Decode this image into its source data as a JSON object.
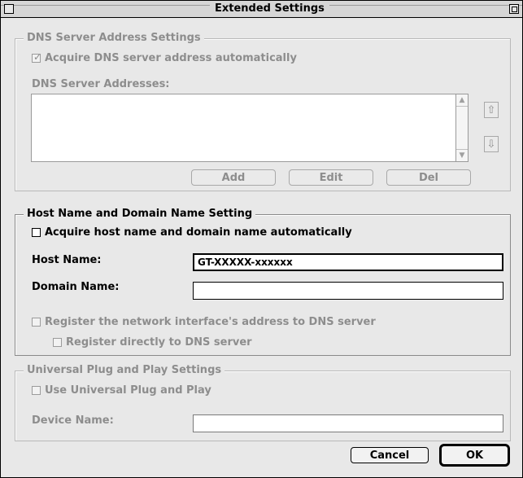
{
  "window": {
    "title": "Extended Settings"
  },
  "dns": {
    "legend": "DNS Server Address Settings",
    "acquire_label": "Acquire DNS server address automatically",
    "acquire_checked": true,
    "addresses_label": "DNS Server Addresses:",
    "add_label": "Add",
    "edit_label": "Edit",
    "del_label": "Del"
  },
  "host": {
    "legend": "Host Name and Domain Name Setting",
    "acquire_label": "Acquire host name and domain name automatically",
    "acquire_checked": false,
    "host_name_label": "Host Name:",
    "host_name_value": "GT-XXXXX-xxxxxx",
    "domain_name_label": "Domain Name:",
    "domain_name_value": "",
    "register_label": "Register the network interface's address to DNS server",
    "register_direct_label": "Register directly to DNS server"
  },
  "upnp": {
    "legend": "Universal Plug and Play Settings",
    "use_label": "Use Universal Plug and Play",
    "device_name_label": "Device Name:",
    "device_name_value": ""
  },
  "footer": {
    "cancel_label": "Cancel",
    "ok_label": "OK"
  },
  "icons": {
    "close": "close-box-icon",
    "zoom": "zoom-box-icon",
    "up": "arrow-up-icon",
    "down": "arrow-down-icon"
  }
}
